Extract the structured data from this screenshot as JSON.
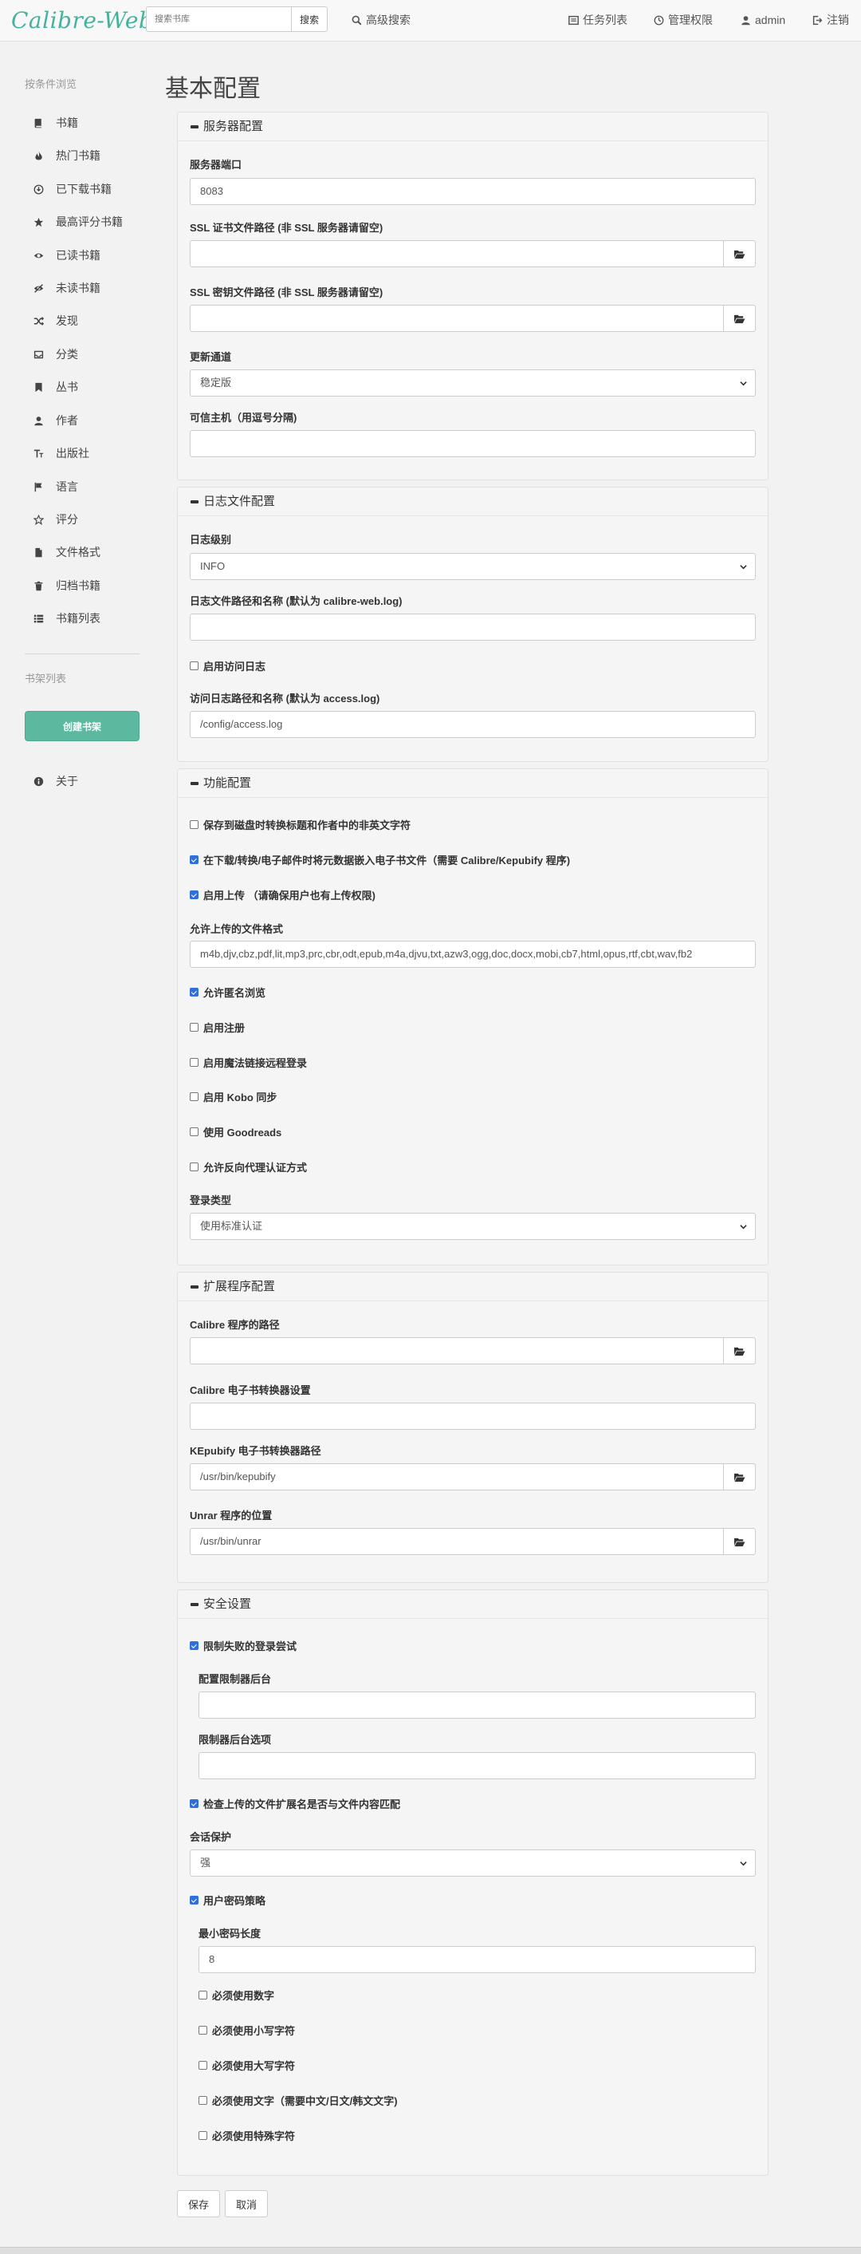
{
  "app": {
    "logo": "Calibre-Web"
  },
  "topbar": {
    "search_placeholder": "搜索书库",
    "search_button": "搜索",
    "advanced_search": "高级搜索",
    "tasks": "任务列表",
    "admin_panel": "管理权限",
    "user": "admin",
    "logout": "注销"
  },
  "sidebar": {
    "browse_header": "按条件浏览",
    "items": [
      {
        "label": "书籍",
        "icon": "book-icon"
      },
      {
        "label": "热门书籍",
        "icon": "fire-icon"
      },
      {
        "label": "已下载书籍",
        "icon": "download-icon"
      },
      {
        "label": "最高评分书籍",
        "icon": "star-icon"
      },
      {
        "label": "已读书籍",
        "icon": "eye-open-icon"
      },
      {
        "label": "未读书籍",
        "icon": "eye-closed-icon"
      },
      {
        "label": "发现",
        "icon": "random-icon"
      },
      {
        "label": "分类",
        "icon": "inbox-icon"
      },
      {
        "label": "丛书",
        "icon": "bookmark-icon"
      },
      {
        "label": "作者",
        "icon": "user-icon"
      },
      {
        "label": "出版社",
        "icon": "text-size-icon"
      },
      {
        "label": "语言",
        "icon": "flag-icon"
      },
      {
        "label": "评分",
        "icon": "star-empty-icon"
      },
      {
        "label": "文件格式",
        "icon": "file-icon"
      },
      {
        "label": "归档书籍",
        "icon": "trash-icon"
      },
      {
        "label": "书籍列表",
        "icon": "list-icon"
      }
    ],
    "shelves_header": "书架列表",
    "create_shelf": "创建书架",
    "about": "关于"
  },
  "page": {
    "title": "基本配置"
  },
  "server": {
    "title": "服务器配置",
    "port_label": "服务器端口",
    "port_value": "8083",
    "ssl_cert_label": "SSL 证书文件路径 (非 SSL 服务器请留空)",
    "ssl_key_label": "SSL 密钥文件路径 (非 SSL 服务器请留空)",
    "update_channel_label": "更新通道",
    "update_channel_value": "稳定版",
    "trusted_hosts_label": "可信主机（用逗号分隔)"
  },
  "logging": {
    "title": "日志文件配置",
    "level_label": "日志级别",
    "level_value": "INFO",
    "logfile_label": "日志文件路径和名称 (默认为 calibre-web.log)",
    "access_log_enable": "启用访问日志",
    "access_log_label": "访问日志路径和名称 (默认为 access.log)",
    "access_log_value": "/config/access.log"
  },
  "features": {
    "title": "功能配置",
    "unicode_filenames": "保存到磁盘时转换标题和作者中的非英文字符",
    "embed_metadata": "在下载/转换/电子邮件时将元数据嵌入电子书文件（需要 Calibre/Kepubify 程序)",
    "enable_uploads": "启用上传 （请确保用户也有上传权限)",
    "upload_formats_label": "允许上传的文件格式",
    "upload_formats_value": "m4b,djv,cbz,pdf,lit,mp3,prc,cbr,odt,epub,m4a,djvu,txt,azw3,ogg,doc,docx,mobi,cb7,html,opus,rtf,cbt,wav,fb2",
    "anon_browse": "允许匿名浏览",
    "public_reg": "启用注册",
    "magic_link": "启用魔法链接远程登录",
    "kobo_sync": "启用 Kobo 同步",
    "goodreads": "使用 Goodreads",
    "reverse_proxy": "允许反向代理认证方式",
    "login_type_label": "登录类型",
    "login_type_value": "使用标准认证"
  },
  "external": {
    "title": "扩展程序配置",
    "calibre_path_label": "Calibre 程序的路径",
    "calibre_settings_label": "Calibre 电子书转换器设置",
    "kepubify_label": "KEpubify 电子书转换器路径",
    "kepubify_value": "/usr/bin/kepubify",
    "unrar_label": "Unrar 程序的位置",
    "unrar_value": "/usr/bin/unrar"
  },
  "security": {
    "title": "安全设置",
    "limit_login": "限制失败的登录尝试",
    "limiter_backend_label": "配置限制器后台",
    "limiter_options_label": "限制器后台选项",
    "check_extensions": "检查上传的文件扩展名是否与文件内容匹配",
    "session_label": "会话保护",
    "session_value": "强",
    "password_policy": "用户密码策略",
    "min_length_label": "最小密码长度",
    "min_length_value": "8",
    "req_number": "必须使用数字",
    "req_lower": "必须使用小写字符",
    "req_upper": "必须使用大写字符",
    "req_letters": "必须使用文字（需要中文/日文/韩文文字)",
    "req_special": "必须使用特殊字符"
  },
  "actions": {
    "save": "保存",
    "cancel": "取消"
  }
}
